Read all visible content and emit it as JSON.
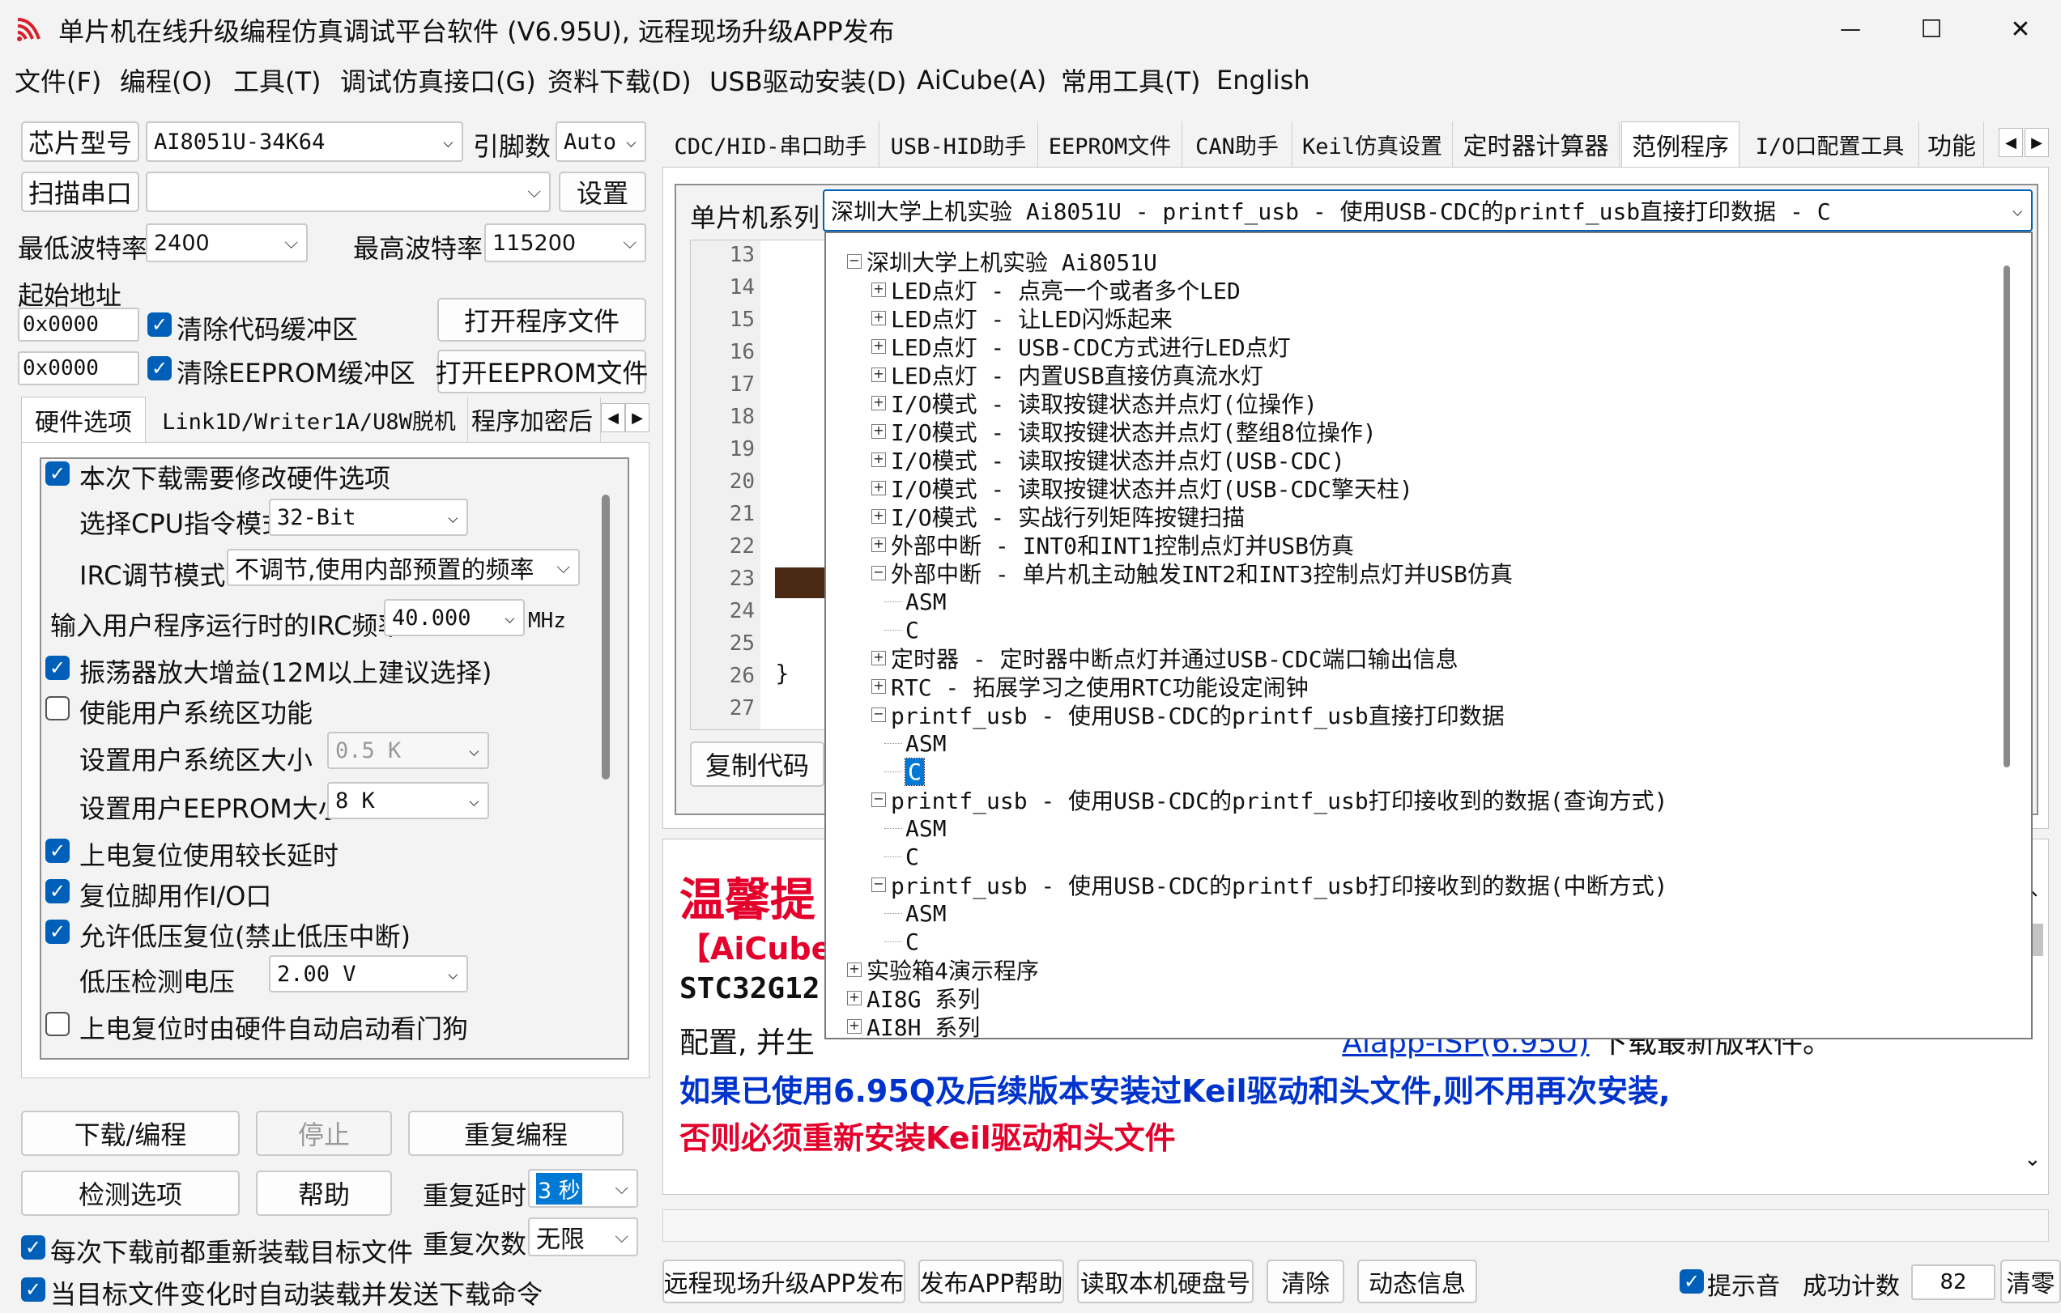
{
  "window": {
    "title": "单片机在线升级编程仿真调试平台软件 (V6.95U), 远程现场升级APP发布",
    "minimize": "—",
    "maximize": "☐",
    "close": "✕"
  },
  "menu": [
    "文件(F)",
    "编程(O)",
    "工具(T)",
    "调试仿真接口(G)",
    "资料下载(D)",
    "USB驱动安装(D)",
    "AiCube(A)",
    "常用工具(T)",
    "English"
  ],
  "left": {
    "chip_label": "芯片型号",
    "chip_value": "AI8051U-34K64",
    "pins_label": "引脚数",
    "pins_value": "Auto",
    "scan_port": "扫描串口",
    "port_value": "",
    "settings": "设置",
    "min_baud_label": "最低波特率",
    "min_baud": "2400",
    "max_baud_label": "最高波特率",
    "max_baud": "115200",
    "start_addr_label": "起始地址",
    "addr1": "0x0000",
    "clear_code": "清除代码缓冲区",
    "open_program": "打开程序文件",
    "addr2": "0x0000",
    "clear_eeprom": "清除EEPROM缓冲区",
    "open_eeprom": "打开EEPROM文件",
    "tabs": [
      "硬件选项",
      "Link1D/Writer1A/U8W脱机",
      "程序加密后"
    ],
    "hw": {
      "modify_hw": "本次下载需要修改硬件选项",
      "cpu_mode_label": "选择CPU指令模式",
      "cpu_mode": "32-Bit",
      "irc_adjust_label": "IRC调节模式",
      "irc_adjust": "不调节,使用内部预置的频率",
      "irc_freq_label": "输入用户程序运行时的IRC频率",
      "irc_freq": "40.000",
      "irc_unit": "MHz",
      "osc_gain": "振荡器放大增益(12M以上建议选择)",
      "user_sys": "使能用户系统区功能",
      "sys_size_label": "设置用户系统区大小",
      "sys_size": "0.5 K",
      "eeprom_size_label": "设置用户EEPROM大小",
      "eeprom_size": "8   K",
      "long_delay": "上电复位使用较长延时",
      "reset_io": "复位脚用作I/O口",
      "low_voltage": "允许低压复位(禁止低压中断)",
      "lv_label": "低压检测电压",
      "lv_value": "2.00 V",
      "watchdog": "上电复位时由硬件自动启动看门狗"
    },
    "download": "下载/编程",
    "stop": "停止",
    "reprogram": "重复编程",
    "check_opts": "检测选项",
    "help": "帮助",
    "repeat_delay_label": "重复延时",
    "repeat_delay": "3 秒",
    "repeat_count_label": "重复次数",
    "repeat_count": "无限",
    "reload_each": "每次下载前都重新装载目标文件",
    "auto_send": "当目标文件变化时自动装载并发送下载命令"
  },
  "right": {
    "tabs": [
      "CDC/HID-串口助手",
      "USB-HID助手",
      "EEPROM文件",
      "CAN助手",
      "Keil仿真设置",
      "定时器计算器",
      "范例程序",
      "I/O口配置工具",
      "功能"
    ],
    "series_label": "单片机系列",
    "series_value": "深圳大学上机实验 Ai8051U - printf_usb - 使用USB-CDC的printf_usb直接打印数据 - C",
    "line_numbers": [
      "13",
      "14",
      "15",
      "16",
      "17",
      "18",
      "19",
      "20",
      "21",
      "22",
      "23",
      "24",
      "25",
      "26",
      "27"
    ],
    "code_brace": "}",
    "copy_code": "复制代码",
    "tree": [
      {
        "level": 0,
        "text": "深圳大学上机实验 Ai8051U",
        "expand": "-"
      },
      {
        "level": 1,
        "text": "LED点灯 - 点亮一个或者多个LED",
        "expand": "+"
      },
      {
        "level": 1,
        "text": "LED点灯 - 让LED闪烁起来",
        "expand": "+"
      },
      {
        "level": 1,
        "text": "LED点灯 - USB-CDC方式进行LED点灯",
        "expand": "+"
      },
      {
        "level": 1,
        "text": "LED点灯 - 内置USB直接仿真流水灯",
        "expand": "+"
      },
      {
        "level": 1,
        "text": "I/O模式 - 读取按键状态并点灯(位操作)",
        "expand": "+"
      },
      {
        "level": 1,
        "text": "I/O模式 - 读取按键状态并点灯(整组8位操作)",
        "expand": "+"
      },
      {
        "level": 1,
        "text": "I/O模式 - 读取按键状态并点灯(USB-CDC)",
        "expand": "+"
      },
      {
        "level": 1,
        "text": "I/O模式 - 读取按键状态并点灯(USB-CDC擎天柱)",
        "expand": "+"
      },
      {
        "level": 1,
        "text": "I/O模式 - 实战行列矩阵按键扫描",
        "expand": "+"
      },
      {
        "level": 1,
        "text": "外部中断 - INT0和INT1控制点灯并USB仿真",
        "expand": "+"
      },
      {
        "level": 1,
        "text": "外部中断 - 单片机主动触发INT2和INT3控制点灯并USB仿真",
        "expand": "-"
      },
      {
        "level": 2,
        "text": "ASM",
        "expand": ""
      },
      {
        "level": 2,
        "text": "C",
        "expand": ""
      },
      {
        "level": 1,
        "text": "定时器 - 定时器中断点灯并通过USB-CDC端口输出信息",
        "expand": "+"
      },
      {
        "level": 1,
        "text": "RTC - 拓展学习之使用RTC功能设定闹钟",
        "expand": "+"
      },
      {
        "level": 1,
        "text": "printf_usb - 使用USB-CDC的printf_usb直接打印数据",
        "expand": "-"
      },
      {
        "level": 2,
        "text": "ASM",
        "expand": ""
      },
      {
        "level": 2,
        "text": "C",
        "expand": "",
        "selected": true
      },
      {
        "level": 1,
        "text": "printf_usb - 使用USB-CDC的printf_usb打印接收到的数据(查询方式)",
        "expand": "-"
      },
      {
        "level": 2,
        "text": "ASM",
        "expand": ""
      },
      {
        "level": 2,
        "text": "C",
        "expand": ""
      },
      {
        "level": 1,
        "text": "printf_usb - 使用USB-CDC的printf_usb打印接收到的数据(中断方式)",
        "expand": "-"
      },
      {
        "level": 2,
        "text": "ASM",
        "expand": ""
      },
      {
        "level": 2,
        "text": "C",
        "expand": ""
      },
      {
        "level": 0,
        "text": "实验箱4演示程序",
        "expand": "+"
      },
      {
        "level": 0,
        "text": "AI8G 系列",
        "expand": "+"
      },
      {
        "level": 0,
        "text": "AI8H 系列",
        "expand": "+"
      }
    ],
    "notice_title": "温馨提",
    "notice_aicube": "【AiCube",
    "notice_stc": "STC32G12",
    "notice_line3_a": "配置, 并生",
    "notice_link": "Aiapp-ISP(6.95U)",
    "notice_line3_b": "下载最新版软件。",
    "notice_blue": "如果已使用6.95Q及后续版本安装过Keil驱动和头文件,则不用再次安装,",
    "notice_red": "否则必须重新安装Keil驱动和头文件"
  },
  "bottom": {
    "publish_app": "远程现场升级APP发布",
    "publish_help": "发布APP帮助",
    "read_disk": "读取本机硬盘号",
    "clear": "清除",
    "dynamic_info": "动态信息",
    "beep": "提示音",
    "success_label": "成功计数",
    "success_count": "82",
    "clear2": "清零"
  },
  "colors": {
    "accent": "#005fb8",
    "notice_red": "#e4002b",
    "notice_blue": "#0033cc",
    "code_block": "#4a2a12"
  }
}
